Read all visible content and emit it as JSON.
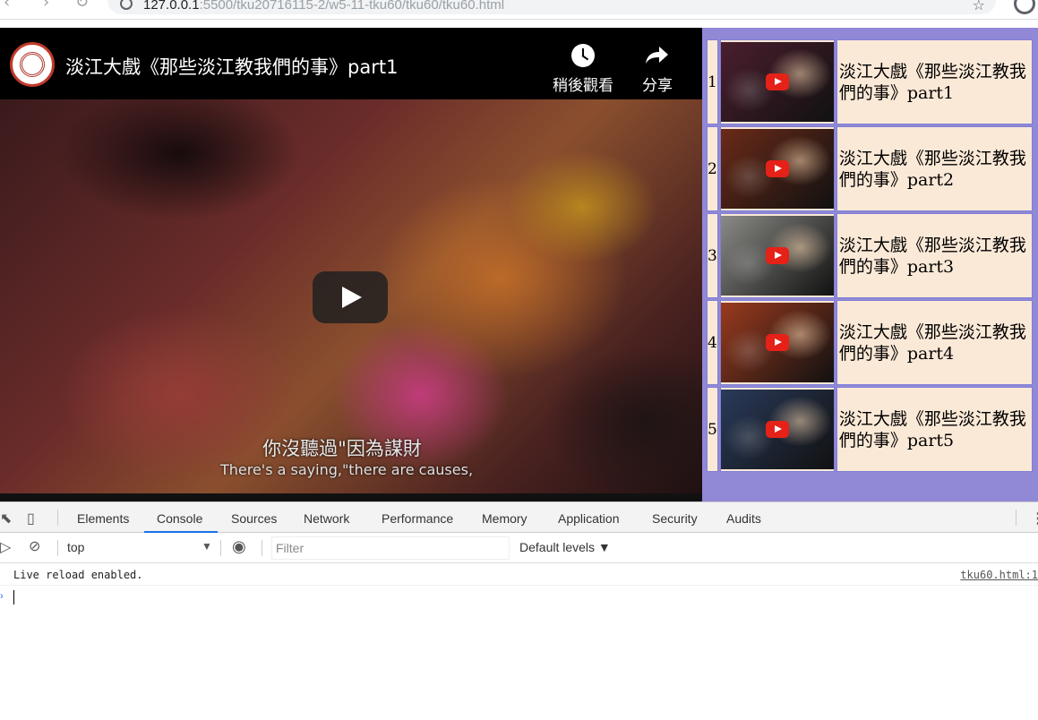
{
  "browser": {
    "url_host": "127.0.0.1",
    "url_path": ":5500/tku20716115-2/w5-11-tku60/tku60/tku60.html"
  },
  "player": {
    "title": "淡江大戲《那些淡江教我們的事》part1",
    "watch_later_label": "稍後觀看",
    "share_label": "分享",
    "subtitle_zh": "你沒聽過\"因為謀財",
    "subtitle_en": "There's a saying,\"there are causes,"
  },
  "playlist": [
    {
      "num": "1",
      "title": "淡江大戲《那些淡江教我們的事》part1",
      "color": "#4a1e2e"
    },
    {
      "num": "2",
      "title": "淡江大戲《那些淡江教我們的事》part2",
      "color": "#6a2a18"
    },
    {
      "num": "3",
      "title": "淡江大戲《那些淡江教我們的事》part3",
      "color": "#8a8a86"
    },
    {
      "num": "4",
      "title": "淡江大戲《那些淡江教我們的事》part4",
      "color": "#9a3a1e"
    },
    {
      "num": "5",
      "title": "淡江大戲《那些淡江教我們的事》part5",
      "color": "#2a3a5a"
    }
  ],
  "devtools": {
    "tabs": [
      "Elements",
      "Console",
      "Sources",
      "Network",
      "Performance",
      "Memory",
      "Application",
      "Security",
      "Audits"
    ],
    "active_tab": "Console",
    "context": "top",
    "filter_placeholder": "Filter",
    "levels": "Default levels ▼",
    "messages": [
      {
        "text": "Live reload enabled.",
        "source": "tku60.html:1"
      }
    ]
  }
}
